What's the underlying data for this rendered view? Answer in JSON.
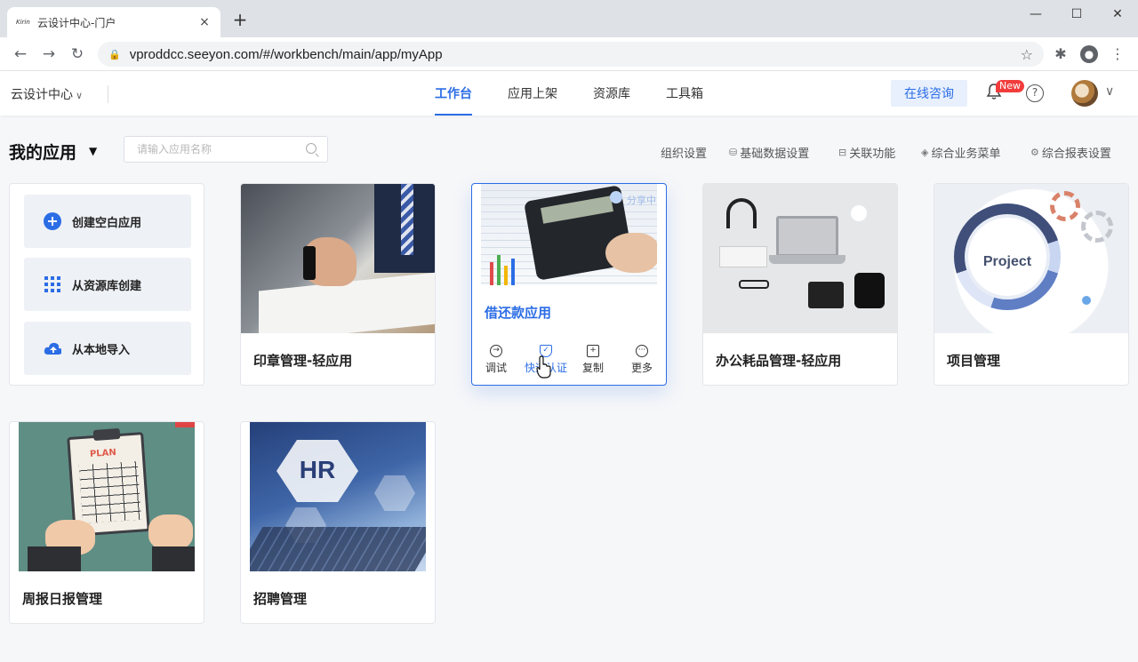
{
  "browser": {
    "tab_favicon": "Kirin",
    "tab_title": "云设计中心-门户",
    "tab_close": "×",
    "new_tab": "+",
    "minimize": "—",
    "maximize": "☐",
    "close": "✕",
    "url": "vproddcc.seeyon.com/#/workbench/main/app/myApp"
  },
  "header": {
    "brand": "云设计中心",
    "nav": [
      "工作台",
      "应用上架",
      "资源库",
      "工具箱"
    ],
    "active_nav": "工作台",
    "consult": "在线咨询",
    "badge": "New",
    "help": "?"
  },
  "toolbar": {
    "title": "我的应用",
    "search_placeholder": "请输入应用名称",
    "links": [
      "组织设置",
      "基础数据设置",
      "关联功能",
      "综合业务菜单",
      "综合报表设置"
    ]
  },
  "create_options": [
    "创建空白应用",
    "从资源库创建",
    "从本地导入"
  ],
  "apps": {
    "seal": "印章管理-轻应用",
    "loan": "借还款应用",
    "loan_share": "分享中",
    "office": "办公耗品管理-轻应用",
    "project": "项目管理",
    "project_badge": "Project",
    "weekly": "周报日报管理",
    "weekly_badge": "PLAN",
    "hr": "招聘管理",
    "hr_badge": "HR"
  },
  "actions": [
    "调试",
    "快速认证",
    "复制",
    "更多"
  ],
  "colors": {
    "primary": "#2b6de5",
    "badge": "#f23c3c",
    "consult_bg": "#e8f0fd"
  }
}
